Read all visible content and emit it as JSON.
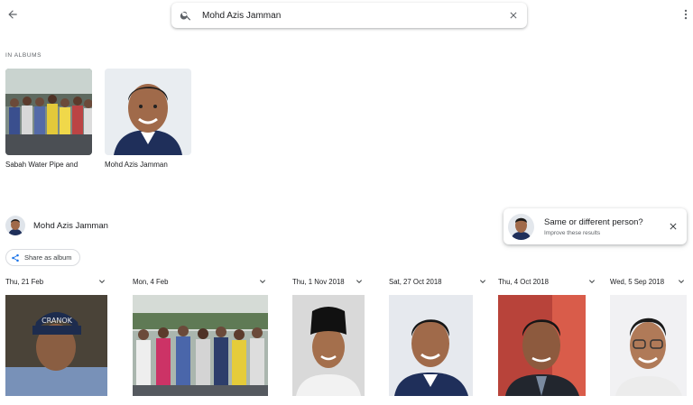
{
  "header": {
    "back_icon": "arrow-back-icon",
    "more_icon": "more-vert-icon",
    "search": {
      "value": "Mohd Azis Jamman",
      "search_icon": "search-icon",
      "clear_icon": "close-icon"
    }
  },
  "albums_section": {
    "label": "IN ALBUMS",
    "albums": [
      {
        "title": "Sabah Water Pipe and"
      },
      {
        "title": "Mohd Azis Jamman"
      }
    ]
  },
  "person": {
    "name": "Mohd Azis Jamman",
    "share_label": "Share as album",
    "share_icon": "share-icon"
  },
  "suggestion": {
    "title": "Same or different person?",
    "subtitle": "Improve these results",
    "close_icon": "close-icon"
  },
  "date_groups": [
    {
      "date": "Thu, 21 Feb"
    },
    {
      "date": "Mon, 4 Feb"
    },
    {
      "date": "Thu, 1 Nov 2018"
    },
    {
      "date": "Sat, 27 Oct 2018"
    },
    {
      "date": "Thu, 4 Oct 2018"
    },
    {
      "date": "Wed, 5 Sep 2018"
    }
  ],
  "colors": {
    "text_primary": "#202124",
    "text_secondary": "#5f6368",
    "icon": "#5f6368",
    "accent": "#1a73e8"
  }
}
